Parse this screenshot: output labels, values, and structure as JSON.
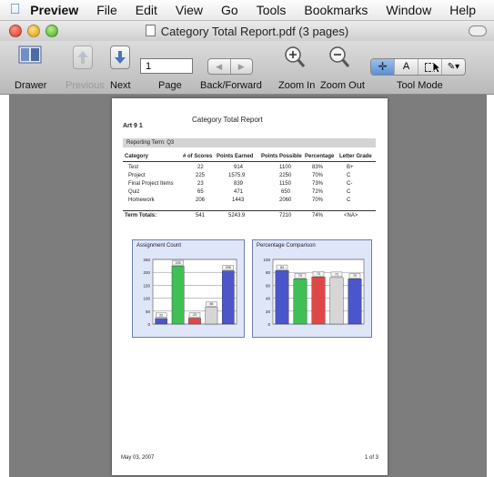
{
  "menubar": {
    "app_name": "Preview",
    "items": [
      "File",
      "Edit",
      "View",
      "Go",
      "Tools",
      "Bookmarks",
      "Window",
      "Help"
    ]
  },
  "window": {
    "title": "Category Total Report.pdf (3 pages)"
  },
  "toolbar": {
    "drawer_label": "Drawer",
    "previous_label": "Previous",
    "next_label": "Next",
    "page_label": "Page",
    "page_value": "1",
    "back_forward_label": "Back/Forward",
    "zoom_in_label": "Zoom In",
    "zoom_out_label": "Zoom Out",
    "tool_mode_label": "Tool Mode",
    "text_tool_glyph": "A"
  },
  "document": {
    "class_name": "Art 9 1",
    "title": "Category Total Report",
    "term_label": "Reporting Term: Q3",
    "columns": [
      "Category",
      "# of Scores",
      "Points Earned",
      "Points Possible",
      "Percentage",
      "Letter Grade"
    ],
    "rows": [
      [
        "Test",
        "22",
        "914",
        "1100",
        "83%",
        "B+"
      ],
      [
        "Project",
        "225",
        "1575.9",
        "2250",
        "70%",
        "C"
      ],
      [
        "Final Project Items",
        "23",
        "839",
        "1150",
        "73%",
        "C-"
      ],
      [
        "Quiz",
        "65",
        "471",
        "650",
        "72%",
        "C"
      ],
      [
        "Homework",
        "206",
        "1443",
        "2060",
        "70%",
        "C"
      ]
    ],
    "totals": [
      "Term Totals:",
      "541",
      "5243.9",
      "7210",
      "74%",
      "<NA>"
    ],
    "footer_date": "May 03, 2007",
    "footer_page": "1 of 3"
  },
  "chart_data": [
    {
      "type": "bar",
      "title": "Assignment Count",
      "ylim": [
        0,
        250
      ],
      "yticks": [
        "0",
        "50",
        "100",
        "150",
        "200",
        "250"
      ],
      "values": [
        22,
        225,
        23,
        65,
        206
      ],
      "colors": [
        "#4a56c9",
        "#3fbf55",
        "#e04848",
        "#d6d6d6",
        "#4a56c9"
      ]
    },
    {
      "type": "bar",
      "title": "Percentage Comparison",
      "ylim": [
        0,
        100
      ],
      "yticks": [
        "0",
        "20",
        "40",
        "60",
        "80",
        "100"
      ],
      "values": [
        83,
        70,
        73,
        72,
        70
      ],
      "colors": [
        "#4a56c9",
        "#3fbf55",
        "#e04848",
        "#d6d6d6",
        "#4a56c9"
      ]
    }
  ]
}
